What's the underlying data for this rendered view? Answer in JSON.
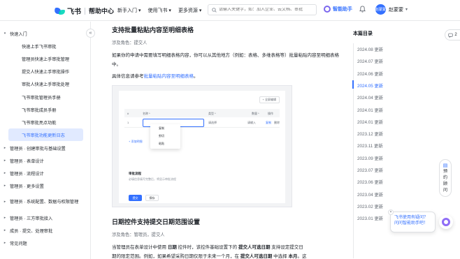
{
  "header": {
    "brand": "飞书",
    "sub": "帮助中心",
    "nav": [
      "新手入门 ▾",
      "使用飞书 ▾",
      "更多资源 ▾"
    ],
    "search_placeholder": "请输入关键字，如：加入企业、云文档、审批",
    "assistant": "智能助手",
    "avatar": "赵蒙蒙",
    "user": "赵蒙蒙"
  },
  "sidebar": {
    "groups": [
      {
        "label": "快速入门",
        "expanded": true
      },
      {
        "label": "管理员 · 创建审批与基础设置"
      },
      {
        "label": "管理员 · 表单设计"
      },
      {
        "label": "管理员 · 流程设计"
      },
      {
        "label": "管理员 · 更多设置"
      },
      {
        "label": "管理员 · 系统配置、数据与权限管理"
      },
      {
        "label": "管理员 · 三方审批接入"
      },
      {
        "label": "成员 · 提交、处理审批"
      },
      {
        "label": "常见问题"
      }
    ],
    "children": [
      "快速上手飞书审批",
      "管理员快速上手审批管理",
      "提交人快速上手审批操作",
      "审批人快速上手审批处理",
      "飞书审批管理员手册",
      "飞书审批成员手册",
      "飞书审批亮点功能",
      "飞书审批功能更新日志"
    ],
    "active_index": 7
  },
  "article": {
    "section1_title": "支持批量粘贴内容至明细表格",
    "section1_meta": "涉及角色：提交人",
    "para1": "如果你的申请中需要填写明细表格内容，你可以从其他地方（例如：表格、多维表格等）批量粘贴内容至明细表格中。",
    "para2_prefix": "具体信息请参考",
    "para2_link": "批量粘贴内容至明细表格",
    "para2_suffix": "。",
    "screenshot": {
      "top_btn": "+ 全屏编辑",
      "cols": [
        "#",
        "名称 *",
        "类型 *",
        "数量 *",
        "操作"
      ],
      "row": [
        "1",
        "",
        "请选择",
        "请输入",
        "复制",
        "删除"
      ],
      "ctx": [
        "复制",
        "剪切",
        "粘贴"
      ],
      "add": "+ 添加明细",
      "flow_title": "审批流程",
      "flow_desc": "必填信息填写完整后，将显示审批流程",
      "submit": "提交",
      "cancel": "保存"
    },
    "section2_title": "日期控件支持提交日期范围设置",
    "section2_meta": "涉及角色：管理员，提交人",
    "para3_a": "当管理员在表单设计中使用 ",
    "para3_b1": "日期",
    "para3_c": " 控件时，该控件基础设置下的 ",
    "para3_b2": "提交人可选日期",
    "para3_d": " 支持设定提交日",
    "para4_a": "期的限定范围。例如，如果希望采购日期仅限于未来一个月，在 ",
    "para4_b": "提交人可选日期",
    "para4_c": " 中选择 ",
    "para4_d": "本月",
    "para4_e": "。这"
  },
  "toc": {
    "title": "本篇目录",
    "items": [
      "2024.08 更新",
      "2024.07 更新",
      "2024.06 更新",
      "2024.05 更新",
      "2024.04 更新",
      "2024.01 更新",
      "2024.01 更新",
      "2023.12 更新",
      "2023.11 更新",
      "2023.09 更新",
      "2023.07 更新",
      "2023.06 更新",
      "2023.04 更新",
      "2023.02 更新",
      "2023.01 更新"
    ],
    "active_index": 3
  },
  "float": {
    "top_btn": "2",
    "feedback": "预约顾问",
    "bubble": "飞书使用有疑问？问问智能助手吧！"
  },
  "colors": {
    "accent": "#3370ff",
    "active_bg": "#e1eaff"
  }
}
